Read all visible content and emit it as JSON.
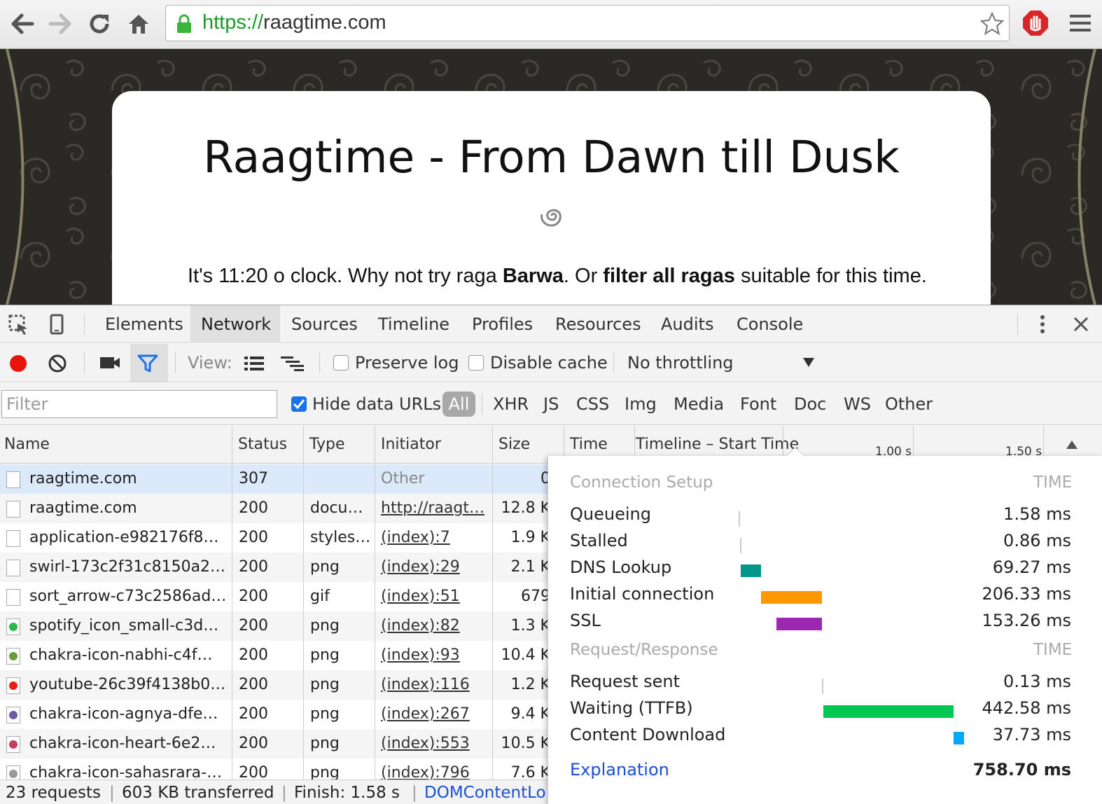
{
  "browser": {
    "url_protocol": "https://",
    "url_host": "raagtime.com"
  },
  "page": {
    "heading": "Raagtime - From Dawn till Dusk",
    "intro_prefix": "It's 11:20 o clock. Why not try raga ",
    "intro_raga": "Barwa",
    "intro_mid": ". Or ",
    "intro_link": "filter all ragas",
    "intro_suffix": " suitable for this time."
  },
  "devtools": {
    "tabs": [
      "Elements",
      "Network",
      "Sources",
      "Timeline",
      "Profiles",
      "Resources",
      "Audits",
      "Console"
    ],
    "active_tab": "Network",
    "toolbar": {
      "view_label": "View:",
      "preserve_log": "Preserve log",
      "disable_cache": "Disable cache",
      "throttling": "No throttling"
    },
    "filter": {
      "placeholder": "Filter",
      "hide_data_urls": "Hide data URLs",
      "types": [
        "All",
        "XHR",
        "JS",
        "CSS",
        "Img",
        "Media",
        "Font",
        "Doc",
        "WS",
        "Other"
      ]
    },
    "columns": {
      "name": "Name",
      "status": "Status",
      "type": "Type",
      "initiator": "Initiator",
      "size": "Size",
      "time": "Time",
      "timeline": "Timeline – Start Time",
      "tick1": "1.00 s",
      "tick2": "1.50 s"
    },
    "rows": [
      {
        "name": "raagtime.com",
        "status": "307",
        "type": "",
        "initiator": "Other",
        "size": "0"
      },
      {
        "name": "raagtime.com",
        "status": "200",
        "type": "docu…",
        "initiator": "http://raagt…",
        "size": "12.8 K"
      },
      {
        "name": "application-e982176f8…",
        "status": "200",
        "type": "styles…",
        "initiator": "(index):7",
        "size": "1.9 K"
      },
      {
        "name": "swirl-173c2f31c8150a2…",
        "status": "200",
        "type": "png",
        "initiator": "(index):29",
        "size": "2.1 K"
      },
      {
        "name": "sort_arrow-c73c2586ad…",
        "status": "200",
        "type": "gif",
        "initiator": "(index):51",
        "size": "679"
      },
      {
        "name": "spotify_icon_small-c3d…",
        "status": "200",
        "type": "png",
        "initiator": "(index):82",
        "size": "1.3 K"
      },
      {
        "name": "chakra-icon-nabhi-c4f…",
        "status": "200",
        "type": "png",
        "initiator": "(index):93",
        "size": "10.4 K"
      },
      {
        "name": "youtube-26c39f4138b0…",
        "status": "200",
        "type": "png",
        "initiator": "(index):116",
        "size": "1.2 K"
      },
      {
        "name": "chakra-icon-agnya-dfe…",
        "status": "200",
        "type": "png",
        "initiator": "(index):267",
        "size": "9.4 K"
      },
      {
        "name": "chakra-icon-heart-6e2…",
        "status": "200",
        "type": "png",
        "initiator": "(index):553",
        "size": "10.5 K"
      },
      {
        "name": "chakra-icon-sahasrara-…",
        "status": "200",
        "type": "png",
        "initiator": "(index):796",
        "size": "7.6 K"
      }
    ],
    "status_bar": {
      "requests": "23 requests",
      "transferred": "603 KB transferred",
      "finish": "Finish: 1.58 s",
      "dom_content": "DOMContentLo"
    }
  },
  "timing": {
    "connection_header": "Connection Setup",
    "time_header": "TIME",
    "request_header": "Request/Response",
    "connection": [
      {
        "label": "Queueing",
        "value": "1.58 ms",
        "color": "#cccccc"
      },
      {
        "label": "Stalled",
        "value": "0.86 ms",
        "color": "#cccccc"
      },
      {
        "label": "DNS Lookup",
        "value": "69.27 ms",
        "color": "#009688"
      },
      {
        "label": "Initial connection",
        "value": "206.33 ms",
        "color": "#ff9800"
      },
      {
        "label": "SSL",
        "value": "153.26 ms",
        "color": "#9c27b0"
      }
    ],
    "request": [
      {
        "label": "Request sent",
        "value": "0.13 ms",
        "color": "#cccccc"
      },
      {
        "label": "Waiting (TTFB)",
        "value": "442.58 ms",
        "color": "#00c853"
      },
      {
        "label": "Content Download",
        "value": "37.73 ms",
        "color": "#03a9f4"
      }
    ],
    "explanation": "Explanation",
    "total": "758.70 ms"
  }
}
